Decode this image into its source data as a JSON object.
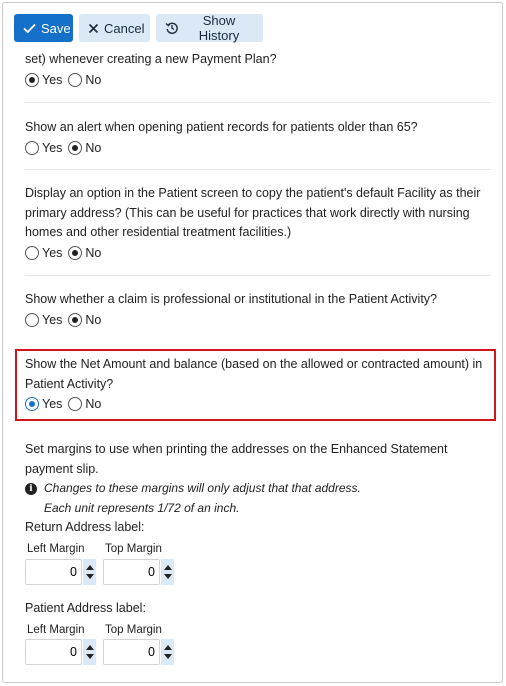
{
  "toolbar": {
    "save_label": "Save",
    "cancel_label": "Cancel",
    "history_label": "Show History"
  },
  "settings": [
    {
      "question": "set) whenever creating a new Payment Plan?",
      "yes": "Yes",
      "no": "No",
      "selected": "yes"
    },
    {
      "question": "Show an alert when opening patient records for patients older than 65?",
      "yes": "Yes",
      "no": "No",
      "selected": "no"
    },
    {
      "question": "Display an option in the Patient screen to copy the patient's default Facility as their primary address? (This can be useful for practices that work directly with nursing homes and other residential treatment facilities.)",
      "yes": "Yes",
      "no": "No",
      "selected": "no"
    },
    {
      "question": "Show whether a claim is professional or institutional in the Patient Activity?",
      "yes": "Yes",
      "no": "No",
      "selected": "no"
    },
    {
      "question": "Show the Net Amount and balance (based on the allowed or contracted amount) in Patient Activity?",
      "yes": "Yes",
      "no": "No",
      "selected": "yes"
    }
  ],
  "margins": {
    "intro": "Set margins to use when printing the addresses on the Enhanced Statement payment slip.",
    "note_line1": "Changes to these margins will only adjust that that address.",
    "note_line2": "Each unit represents 1/72 of an inch.",
    "return_label": "Return Address label:",
    "patient_label": "Patient Address label:",
    "left_margin_label": "Left Margin",
    "top_margin_label": "Top Margin",
    "return_left_value": "0",
    "return_top_value": "0",
    "patient_left_value": "0",
    "patient_top_value": "0"
  },
  "colors": {
    "accent": "#1570c9",
    "accent_light": "#dbe9f7",
    "highlight": "#d0171c"
  }
}
